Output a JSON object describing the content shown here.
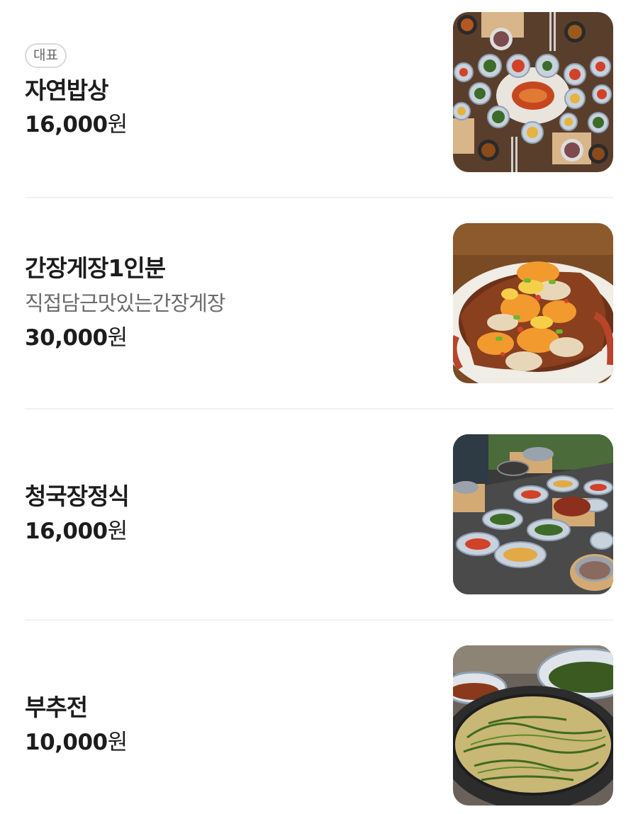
{
  "menu": {
    "items": [
      {
        "badge": "대표",
        "name": "자연밥상",
        "description": "",
        "price": "16,000",
        "currency": "원",
        "photo_icon": "korean-table-setting-photo"
      },
      {
        "badge": "",
        "name": "간장게장1인분",
        "description": "직접담근맛있는간장게장",
        "price": "30,000",
        "currency": "원",
        "photo_icon": "soy-crab-photo"
      },
      {
        "badge": "",
        "name": "청국장정식",
        "description": "",
        "price": "16,000",
        "currency": "원",
        "photo_icon": "cheonggukjang-set-photo"
      },
      {
        "badge": "",
        "name": "부추전",
        "description": "",
        "price": "10,000",
        "currency": "원",
        "photo_icon": "chive-pancake-photo"
      }
    ]
  }
}
